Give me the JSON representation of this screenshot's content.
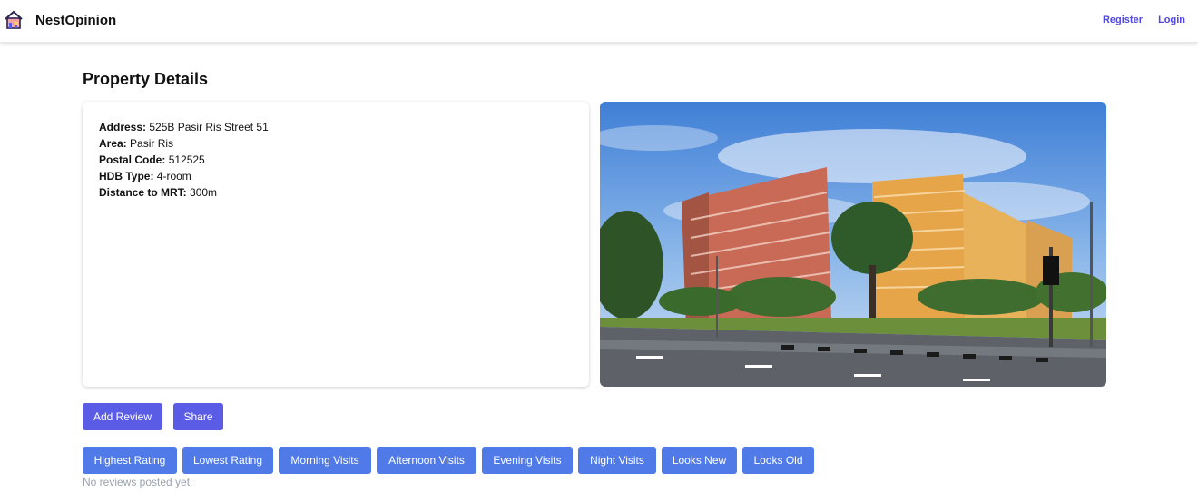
{
  "header": {
    "brand": "NestOpinion",
    "logo_icon": "house-icon",
    "register_label": "Register",
    "login_label": "Login"
  },
  "page": {
    "title": "Property Details"
  },
  "property": {
    "address_label": "Address:",
    "address_value": "525B Pasir Ris Street 51",
    "area_label": "Area:",
    "area_value": "Pasir Ris",
    "postal_label": "Postal Code:",
    "postal_value": "512525",
    "type_label": "HDB Type:",
    "type_value": "4-room",
    "mrt_label": "Distance to MRT:",
    "mrt_value": "300m"
  },
  "actions": {
    "add_review": "Add Review",
    "share": "Share"
  },
  "filters": [
    "Highest Rating",
    "Lowest Rating",
    "Morning Visits",
    "Afternoon Visits",
    "Evening Visits",
    "Night Visits",
    "Looks New",
    "Looks Old"
  ],
  "reviews": {
    "empty_message": "No reviews posted yet."
  },
  "colors": {
    "accent": "#5b5ce6",
    "filter": "#4f7ae8",
    "link": "#4f46e5"
  }
}
